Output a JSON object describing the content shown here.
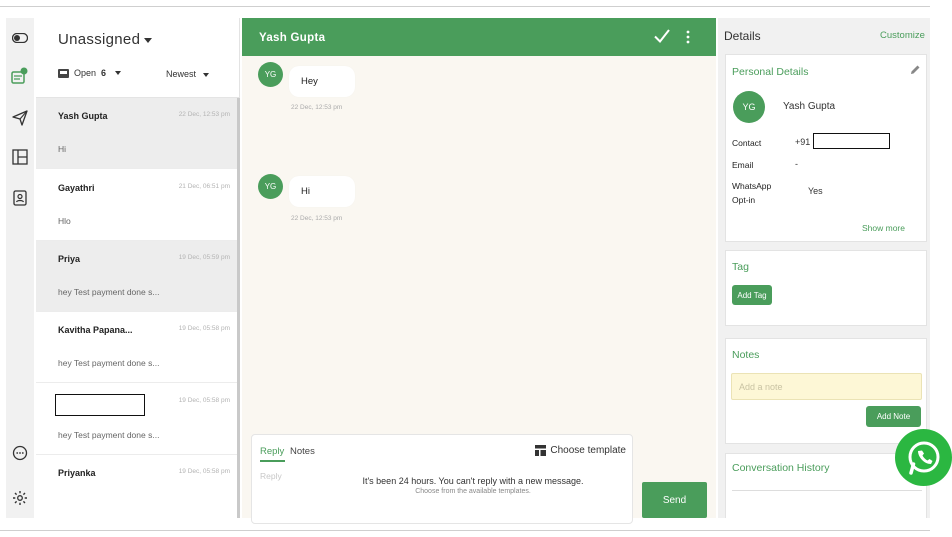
{
  "list": {
    "filter": "Unassigned",
    "status": "Open",
    "count": "6",
    "sort": "Newest",
    "conversations": [
      {
        "name": "Yash Gupta",
        "date": "22 Dec, 12:53 pm",
        "preview": "Hi"
      },
      {
        "name": "Gayathri",
        "date": "21 Dec, 06:51 pm",
        "preview": "Hlo"
      },
      {
        "name": "Priya",
        "date": "19 Dec, 05:59 pm",
        "preview": "hey Test payment done s..."
      },
      {
        "name": "Kavitha Papana...",
        "date": "19 Dec, 05:58 pm",
        "preview": "hey Test payment done s..."
      },
      {
        "name": "",
        "date": "19 Dec, 05:58 pm",
        "preview": "hey Test payment done s..."
      },
      {
        "name": "Priyanka",
        "date": "19 Dec, 05:58 pm",
        "preview": ""
      }
    ]
  },
  "chat": {
    "contact_name": "Yash Gupta",
    "messages": [
      {
        "initials": "YG",
        "text": "Hey",
        "time": "22 Dec, 12:53 pm"
      },
      {
        "initials": "YG",
        "text": "Hi",
        "time": "22 Dec, 12:53 pm"
      }
    ],
    "composer": {
      "tab_reply": "Reply",
      "tab_notes": "Notes",
      "choose_template": "Choose template",
      "placeholder": "Reply",
      "warning": "It's been 24 hours. You can't reply with a new message.",
      "warning_sub": "Choose from the available templates.",
      "send_label": "Send"
    }
  },
  "details": {
    "title": "Details",
    "customize": "Customize",
    "personal": {
      "title": "Personal Details",
      "initials": "YG",
      "name": "Yash Gupta",
      "contact_label": "Contact",
      "contact_value": "+91",
      "email_label": "Email",
      "email_value": "-",
      "optin_label_line1": "WhatsApp",
      "optin_label_line2": "Opt-in",
      "optin_value": "Yes",
      "show_more": "Show more"
    },
    "tag": {
      "title": "Tag",
      "add_label": "Add Tag"
    },
    "notes": {
      "title": "Notes",
      "placeholder": "Add a note",
      "add_label": "Add Note"
    },
    "history": {
      "title": "Conversation History"
    }
  },
  "colors": {
    "brand_green": "#4a9d5b",
    "whatsapp_green": "#2bb741"
  }
}
